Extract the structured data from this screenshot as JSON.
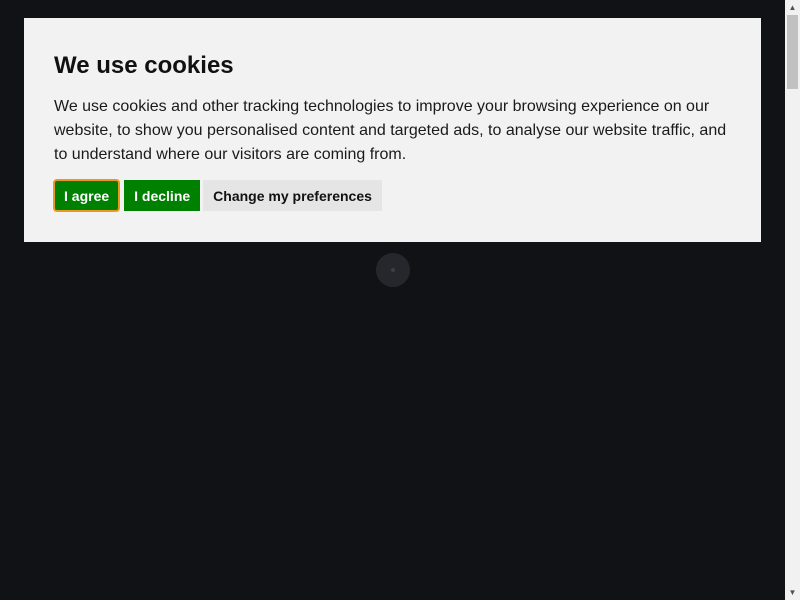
{
  "cookie_banner": {
    "title": "We use cookies",
    "body": "We use cookies and other tracking technologies to improve your browsing experience on our website, to show you personalised content and targeted ads, to analyse our website traffic, and to understand where our visitors are coming from.",
    "buttons": {
      "agree": "I agree",
      "decline": "I decline",
      "preferences": "Change my preferences"
    }
  },
  "icons": {
    "loader": "spinner-icon",
    "scroll_up": "scroll-up-arrow-icon",
    "scroll_down": "scroll-down-arrow-icon"
  },
  "colors": {
    "page_background": "#111216",
    "dialog_background": "#f2f2f2",
    "accept_green": "#008000",
    "focus_outline": "#e89a1a"
  }
}
